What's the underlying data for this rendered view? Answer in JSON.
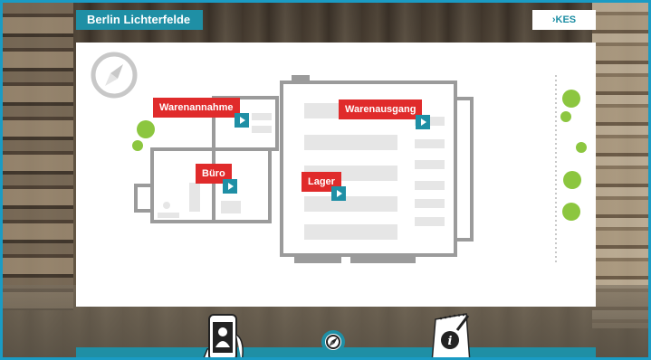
{
  "header": {
    "location_title": "Berlin Lichterfelde",
    "brand_logo": "KES",
    "brand_chevron": "›"
  },
  "map": {
    "compass_icon": "compass-icon",
    "areas": [
      {
        "id": "warenannahme",
        "label": "Warenannahme"
      },
      {
        "id": "warenausgang",
        "label": "Warenausgang"
      },
      {
        "id": "buero",
        "label": "Büro"
      },
      {
        "id": "lager",
        "label": "Lager"
      }
    ]
  },
  "colors": {
    "accent": "#1f8fa5",
    "label_red": "#e02b2b",
    "marker_green": "#8cc63f",
    "wall_gray": "#9b9b9b",
    "frame_blue": "#1a9bc4"
  },
  "toolbar": {
    "icons": [
      "phone-contact-icon",
      "compass-icon",
      "notepad-pen-icon"
    ]
  }
}
